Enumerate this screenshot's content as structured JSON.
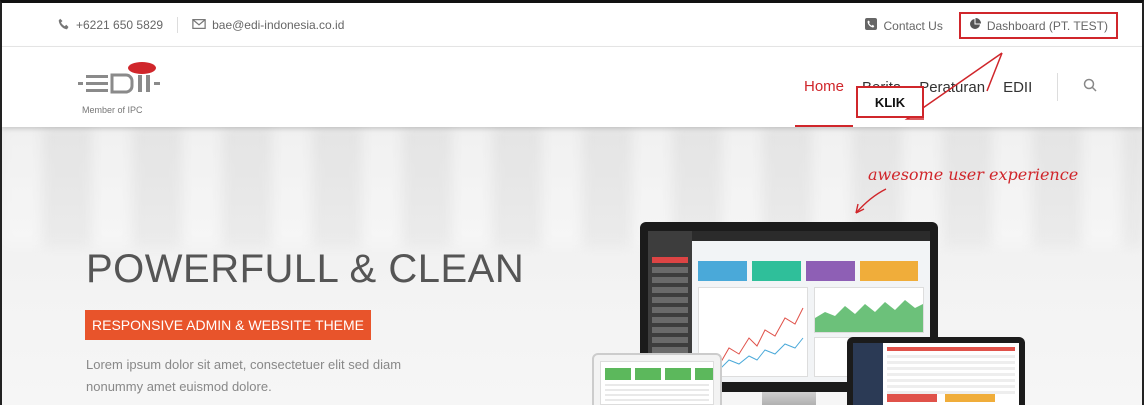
{
  "topbar": {
    "phone": "+6221 650 5829",
    "email": "bae@edi-indonesia.co.id",
    "contact_label": "Contact Us",
    "dashboard_label": "Dashboard (PT. TEST)"
  },
  "header": {
    "logo_text": "EDII",
    "logo_sub": "Member of IPC",
    "nav": [
      "Home",
      "Berita",
      "Peraturan",
      "EDII"
    ]
  },
  "annotation": {
    "klik": "KLIK"
  },
  "hero": {
    "title": "POWERFULL & CLEAN",
    "badge": "RESPONSIVE ADMIN & WEBSITE THEME",
    "text": "Lorem ipsum dolor sit amet, consectetuer elit sed diam nonummy amet euismod dolore.",
    "handwriting": "awesome user experience"
  },
  "colors": {
    "accent": "#d0262b",
    "badge": "#e8542b"
  }
}
